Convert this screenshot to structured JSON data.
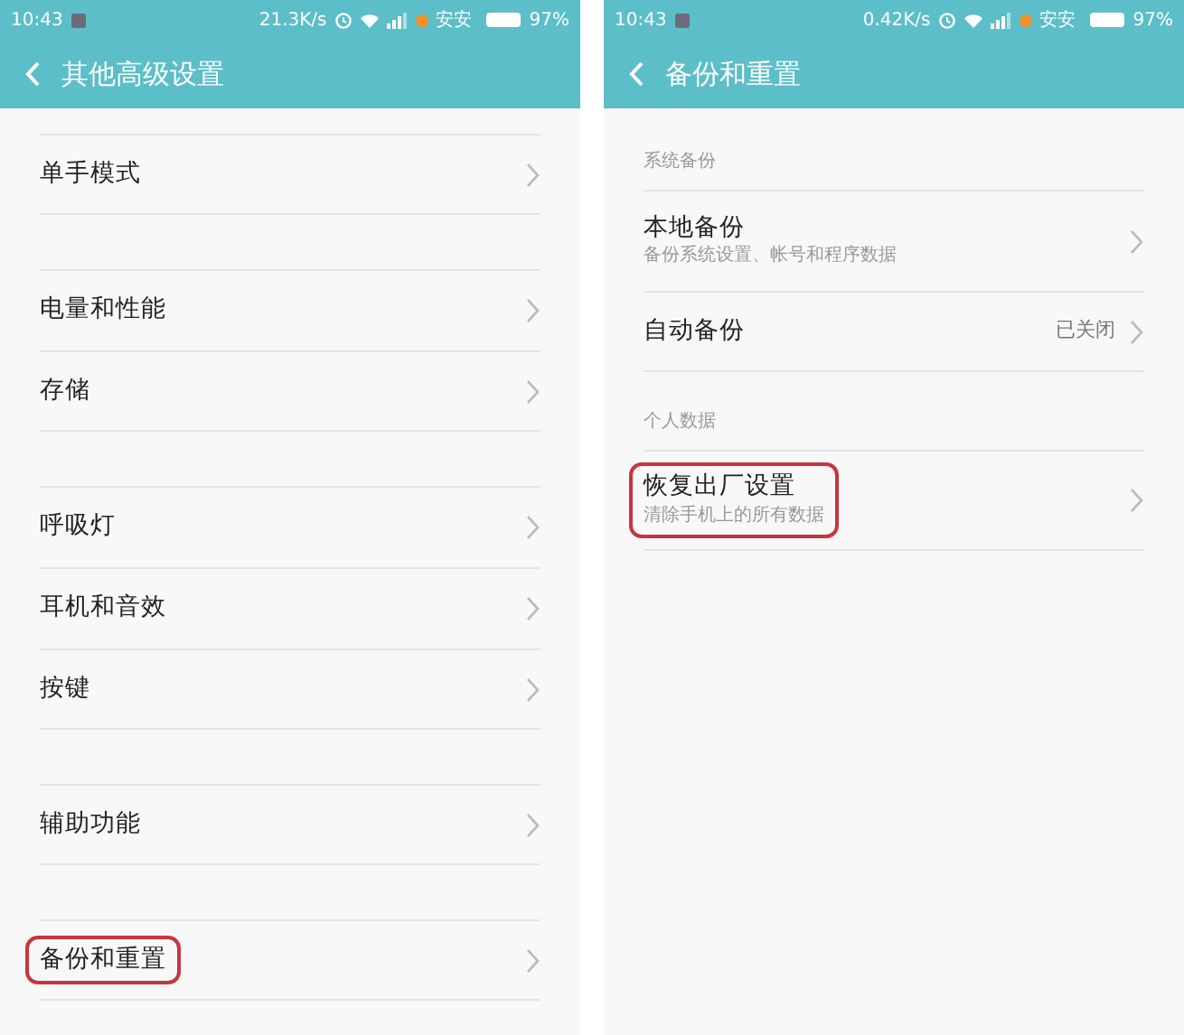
{
  "panels": [
    {
      "status_bar": {
        "time": "10:43",
        "speed": "21.3K/s",
        "carrier": "安安",
        "battery": "97%"
      },
      "title": "其他高级设置",
      "groups": [
        {
          "items": [
            {
              "label": "单手模式",
              "highlighted": false
            }
          ]
        },
        {
          "items": [
            {
              "label": "电量和性能",
              "highlighted": false
            },
            {
              "label": "存储",
              "highlighted": false
            }
          ]
        },
        {
          "items": [
            {
              "label": "呼吸灯",
              "highlighted": false
            },
            {
              "label": "耳机和音效",
              "highlighted": false
            },
            {
              "label": "按键",
              "highlighted": false
            }
          ]
        },
        {
          "items": [
            {
              "label": "辅助功能",
              "highlighted": false
            }
          ]
        },
        {
          "items": [
            {
              "label": "备份和重置",
              "highlighted": true
            }
          ]
        }
      ]
    },
    {
      "status_bar": {
        "time": "10:43",
        "speed": "0.42K/s",
        "carrier": "安安",
        "battery": "97%"
      },
      "title": "备份和重置",
      "groups": [
        {
          "header": "系统备份",
          "items": [
            {
              "label": "本地备份",
              "subtitle": "备份系统设置、帐号和程序数据",
              "highlighted": false
            },
            {
              "label": "自动备份",
              "value": "已关闭",
              "highlighted": false
            }
          ]
        },
        {
          "header": "个人数据",
          "items": [
            {
              "label": "恢复出厂设置",
              "subtitle": "清除手机上的所有数据",
              "highlighted": true
            }
          ]
        }
      ]
    }
  ]
}
